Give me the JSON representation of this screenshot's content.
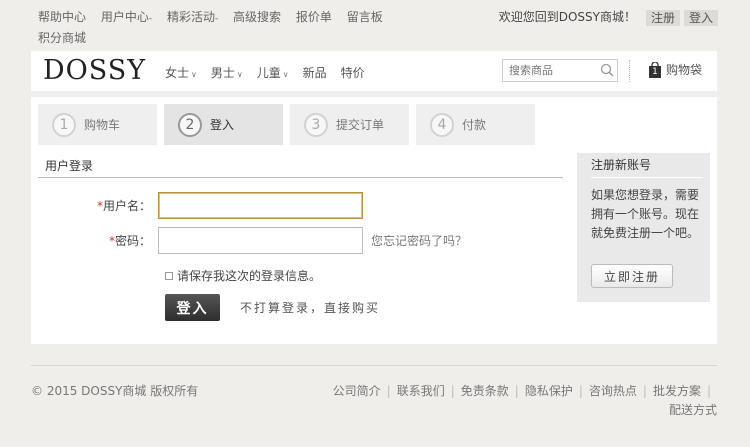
{
  "topnav": {
    "items": [
      "帮助中心",
      "用户中心",
      "精彩活动",
      "高级搜索",
      "报价单",
      "留言板",
      "积分商城"
    ],
    "welcome": "欢迎您回到DOSSY商城！",
    "register": "注册",
    "login": "登入"
  },
  "header": {
    "logo": "DOSSY",
    "nav": [
      "女士",
      "男士",
      "儿童",
      "新品",
      "特价"
    ],
    "search_placeholder": "搜索商品",
    "cart_count": "1",
    "cart_label": "购物袋"
  },
  "steps": [
    {
      "num": "1",
      "label": "购物车"
    },
    {
      "num": "2",
      "label": "登入"
    },
    {
      "num": "3",
      "label": "提交订单"
    },
    {
      "num": "4",
      "label": "付款"
    }
  ],
  "login": {
    "title": "用户登录",
    "username_label": "用户名：",
    "password_label": "密码：",
    "forgot": "您忘记密码了吗？",
    "remember": "请保存我这次的登录信息。",
    "submit": "登入",
    "guest": "不打算登录，直接购买"
  },
  "register": {
    "title": "注册新账号",
    "text": "如果您想登录，需要拥有一个账号。现在就免费注册一个吧。",
    "button": "立即注册"
  },
  "footer": {
    "copyright": "© 2015 DOSSY商城 版权所有",
    "links": [
      "公司简介",
      "联系我们",
      "免责条款",
      "隐私保护",
      "咨询热点",
      "批发方案",
      "配送方式"
    ]
  }
}
